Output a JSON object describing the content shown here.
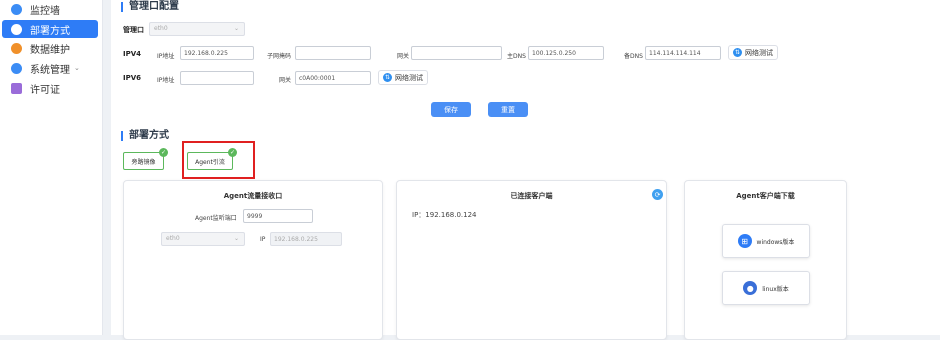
{
  "sidebar": {
    "items": [
      {
        "label": "监控墙",
        "icon": "cloud-icon",
        "color": "#3b8cf5"
      },
      {
        "label": "部署方式",
        "icon": "monitor-icon",
        "color": "#ffffff",
        "active": true
      },
      {
        "label": "数据维护",
        "icon": "database-icon",
        "color": "#f0902a"
      },
      {
        "label": "系统管理",
        "icon": "gear-icon",
        "color": "#3b8cf5",
        "expandable": true
      },
      {
        "label": "许可证",
        "icon": "license-icon",
        "color": "#9a6cd9"
      }
    ]
  },
  "mgmt": {
    "title": "管理口配置",
    "port_label": "管理口",
    "port_value": "eth0",
    "ipv4": {
      "label": "IPV4",
      "ip_label": "IP地址",
      "ip_value": "192.168.0.225",
      "mask_label": "子网掩码",
      "mask_value": "",
      "gw_label": "网关",
      "gw_value": "",
      "dns1_label": "主DNS",
      "dns1_value": "100.125.0.250",
      "dns2_label": "备DNS",
      "dns2_value": "114.114.114.114",
      "test_label": "网络测试"
    },
    "ipv6": {
      "label": "IPV6",
      "ip_label": "IP地址",
      "ip_value": "",
      "gw_label": "网关",
      "gw_value": "c0A00:0001",
      "test_label": "网络测试"
    },
    "save_label": "保存",
    "reset_label": "重置"
  },
  "deploy": {
    "title": "部署方式",
    "modes": [
      {
        "label": "旁路镜像",
        "selected": true
      },
      {
        "label": "Agent引流",
        "selected": true
      }
    ]
  },
  "cards": {
    "receiver": {
      "title": "Agent流量接收口",
      "port_label": "Agent监听端口",
      "port_value": "9999",
      "iface_value": "eth0",
      "ip_label": "IP",
      "ip_value": "192.168.0.225"
    },
    "clients": {
      "title": "已连接客户端",
      "ip_text": "IP：192.168.0.124"
    },
    "download": {
      "title": "Agent客户端下载",
      "windows_label": "windows版本",
      "linux_label": "linux版本"
    }
  },
  "colors": {
    "accent": "#2e7cf6",
    "success": "#5cb85c",
    "highlight": "#e02020"
  }
}
